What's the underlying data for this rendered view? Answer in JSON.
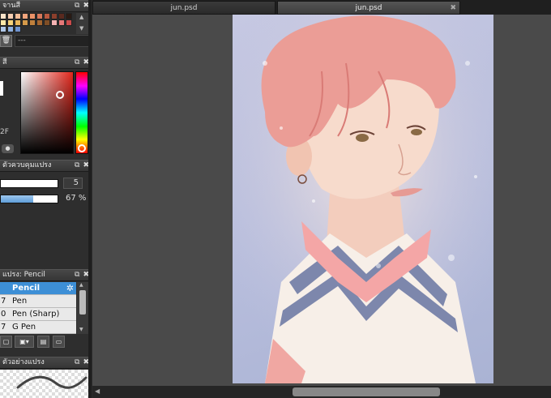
{
  "panels": {
    "palette": {
      "title": "จานสี",
      "palette_name": "---",
      "swatches": [
        "#fbe3c9",
        "#f8cfb2",
        "#f4bd98",
        "#f0a47c",
        "#ea9267",
        "#d8785a",
        "#b9593f",
        "#8c3f2c",
        "#5a2a1f",
        "#2a1a14",
        "#ffe8a8",
        "#f6d27a",
        "#e9b65a",
        "#d59a4a",
        "#c0803c",
        "#a56630",
        "#7f4e26",
        "#f4b2b2",
        "#e57878",
        "#c94a4a",
        "#b0c8e8",
        "#8fb0df",
        "#6f93cf"
      ]
    },
    "color": {
      "title": "สี",
      "hex_fragment": "2F"
    },
    "brush_control": {
      "title": "ตัวควบคุมแปรง",
      "size_value": "5",
      "opacity_value": "67 %",
      "opacity": 0.67
    },
    "brush": {
      "title": "แปรง: Pencil",
      "items": [
        {
          "index": "",
          "name": "Pencil",
          "selected": true
        },
        {
          "index": "7",
          "name": "Pen",
          "selected": false
        },
        {
          "index": "0",
          "name": "Pen (Sharp)",
          "selected": false
        },
        {
          "index": "7",
          "name": "G Pen",
          "selected": false
        }
      ],
      "toolbar_icons": [
        "new-brush-icon",
        "brush-menu-icon",
        "copy-brush-icon",
        "folder-icon"
      ]
    },
    "brush_preview": {
      "title": "ตัวอย่างแปรง"
    }
  },
  "tabs": [
    {
      "label": "jun.psd",
      "active": false
    },
    {
      "label": "jun.psd",
      "active": true
    }
  ],
  "colors": {
    "selection": "#3d8fd6",
    "canvas_bg": "#4a4a4a"
  }
}
